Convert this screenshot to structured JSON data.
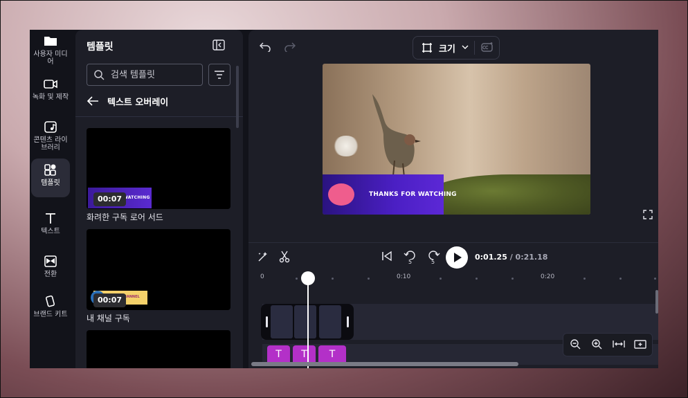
{
  "rail": {
    "items": [
      {
        "label": "사용자 미디어",
        "icon": "folder-icon"
      },
      {
        "label": "녹화 및 제작",
        "icon": "video-camera-icon"
      },
      {
        "label": "콘텐츠 라이브러리",
        "icon": "media-library-icon"
      },
      {
        "label": "템플릿",
        "icon": "templates-icon"
      },
      {
        "label": "텍스트",
        "icon": "text-icon"
      },
      {
        "label": "전환",
        "icon": "transition-icon"
      },
      {
        "label": "브랜드 키트",
        "icon": "brand-kit-icon"
      }
    ]
  },
  "panel": {
    "title": "템플릿",
    "search_placeholder": "검색 템플릿",
    "back_label": "텍스트 오버레이",
    "cards": [
      {
        "name": "화려한 구독 로어 서드",
        "duration": "00:07",
        "overlay_text": "FOR WATCHING"
      },
      {
        "name": "내 채널 구독",
        "duration": "00:07",
        "overlay_text": "CHANNEL"
      }
    ]
  },
  "toolbar": {
    "resize_label": "크기"
  },
  "preview": {
    "banner_text": "THANKS FOR WATCHING"
  },
  "playback": {
    "current_time": "0:01.25",
    "total_time": "/ 0:21.18",
    "skip_back_seconds": "5",
    "skip_forward_seconds": "5"
  },
  "timeline": {
    "ruler_labels": [
      "0",
      "0:10",
      "0:20"
    ],
    "text_clip_label": "T"
  },
  "colors": {
    "accent_purple": "#b330c8",
    "banner_blue": "#4b1fc4",
    "app_bg": "#12131a"
  }
}
